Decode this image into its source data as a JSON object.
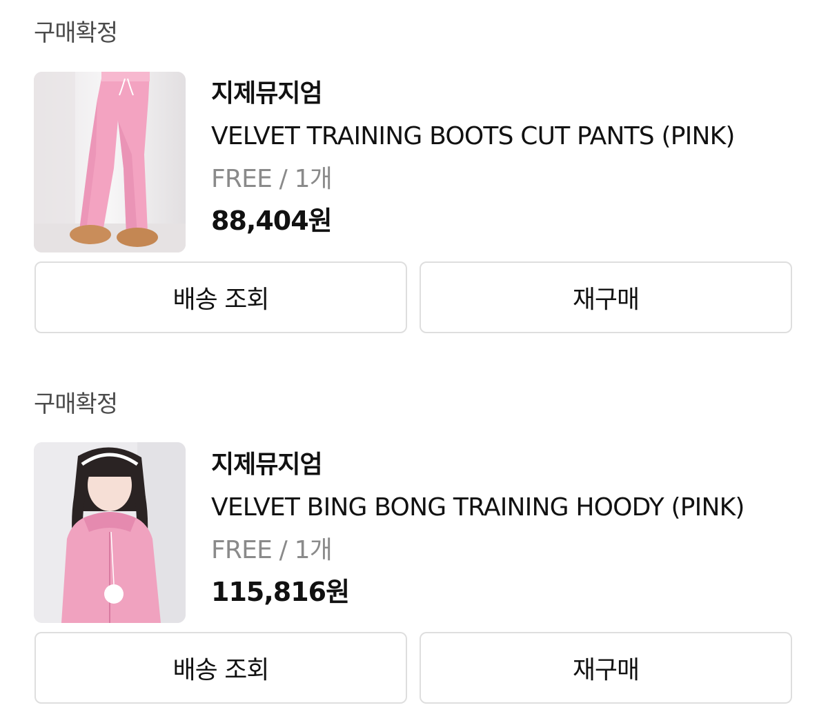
{
  "orders": [
    {
      "status": "구매확정",
      "brand": "지제뮤지엄",
      "product_name": "VELVET TRAINING BOOTS CUT PANTS (PINK)",
      "option": "FREE / 1개",
      "price": "88,404원",
      "image_icon": "product-photo-pink-pants",
      "buttons": {
        "delivery": "배송 조회",
        "reorder": "재구매"
      }
    },
    {
      "status": "구매확정",
      "brand": "지제뮤지엄",
      "product_name": "VELVET BING BONG TRAINING HOODY (PINK)",
      "option": "FREE / 1개",
      "price": "115,816원",
      "image_icon": "product-photo-pink-hoodie",
      "buttons": {
        "delivery": "배송 조회",
        "reorder": "재구매"
      }
    }
  ],
  "colors": {
    "status_text": "#4b4b4b",
    "option_text": "#8a8a8a",
    "button_border": "#dedede",
    "product_pink": "#f3a3c1"
  }
}
